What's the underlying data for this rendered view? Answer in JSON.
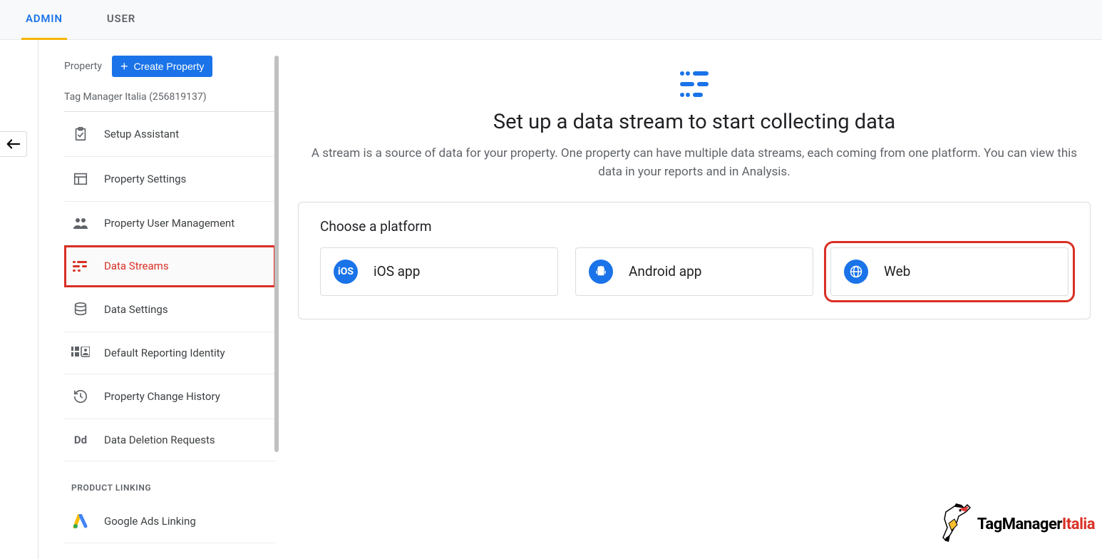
{
  "tabs": {
    "admin": "ADMIN",
    "user": "USER"
  },
  "sidebar": {
    "property_label": "Property",
    "create_button": "Create Property",
    "property_name": "Tag Manager Italia (256819137)",
    "items": [
      {
        "label": "Setup Assistant"
      },
      {
        "label": "Property Settings"
      },
      {
        "label": "Property User Management"
      },
      {
        "label": "Data Streams"
      },
      {
        "label": "Data Settings"
      },
      {
        "label": "Default Reporting Identity"
      },
      {
        "label": "Property Change History"
      },
      {
        "label": "Data Deletion Requests"
      }
    ],
    "section_header": "PRODUCT LINKING",
    "linking": [
      {
        "label": "Google Ads Linking"
      }
    ]
  },
  "main": {
    "title": "Set up a data stream to start collecting data",
    "subtitle": "A stream is a source of data for your property. One property can have multiple data streams, each coming from one platform. You can view this data in your reports and in Analysis.",
    "choose_platform": "Choose a platform",
    "platforms": {
      "ios": "iOS app",
      "android": "Android app",
      "web": "Web"
    }
  },
  "brand": {
    "part1": "TagManager",
    "part2": "Italia"
  }
}
